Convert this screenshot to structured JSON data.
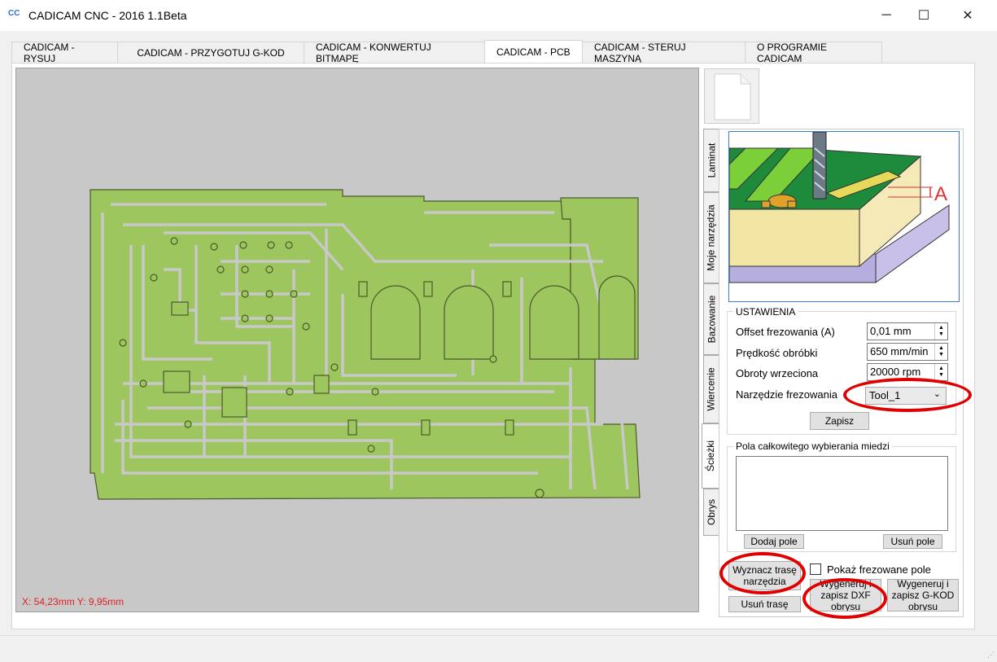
{
  "window": {
    "icon_text": "CC",
    "title": "CADICAM CNC - 2016 1.1Beta",
    "minimize_glyph": "─",
    "maximize_glyph": "☐",
    "close_glyph": "✕"
  },
  "tabs": [
    {
      "label": "CADICAM - RYSUJ"
    },
    {
      "label": "CADICAM - PRZYGOTUJ G-KOD"
    },
    {
      "label": "CADICAM - KONWERTUJ BITMAPĘ"
    },
    {
      "label": "CADICAM - PCB"
    },
    {
      "label": "CADICAM - STERUJ MASZYNĄ"
    },
    {
      "label": "O PROGRAMIE CADICAM"
    }
  ],
  "active_tab": "CADICAM - PCB",
  "canvas": {
    "coords": "X: 54,23mm Y: 9,95mm",
    "pcb_color": "#9dc65e",
    "trace_color": "#4a5a2a"
  },
  "vertical_tabs": [
    {
      "label": "Laminat"
    },
    {
      "label": "Moje narzędzia"
    },
    {
      "label": "Bazowanie"
    },
    {
      "label": "Wiercenie"
    },
    {
      "label": "Ścieżki"
    },
    {
      "label": "Obrys"
    }
  ],
  "active_vertical_tab": "Ścieżki",
  "illustration": {
    "label": "A"
  },
  "settings": {
    "title": "USTAWIENIA",
    "offset_label": "Offset frezowania (A)",
    "offset_value": "0,01 mm",
    "speed_label": "Prędkość obróbki",
    "speed_value": "650 mm/min",
    "rpm_label": "Obroty wrzeciona",
    "rpm_value": "20000 rpm",
    "tool_label": "Narzędzie frezowania",
    "tool_value": "Tool_1",
    "save_label": "Zapisz"
  },
  "copper_fields": {
    "title": "Pola całkowitego wybierania miedzi",
    "add_label": "Dodaj pole",
    "remove_label": "Usuń pole"
  },
  "actions": {
    "trace_path_label": "Wyznacz trasę narzędzia",
    "show_milled_label": "Pokaż frezowane pole",
    "remove_path_label": "Usuń trasę",
    "gen_dxf_label": "Wygeneruj i zapisz DXF obrysu",
    "gen_gcode_label": "Wygeneruj i zapisz G-KOD obrysu"
  },
  "highlight_color": "#e00000"
}
